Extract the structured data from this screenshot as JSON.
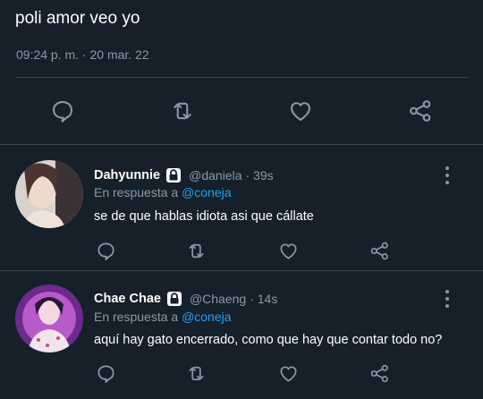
{
  "tweet": {
    "text": "poli amor veo yo",
    "meta": "09:24 p. m. · 20 mar. 22"
  },
  "icons": {
    "reply": "comment-icon",
    "retweet": "retweet-icon",
    "like": "heart-icon",
    "share": "share-icon",
    "lock": "lock-icon",
    "more": "more-vertical-icon"
  },
  "colors": {
    "background": "#15202b",
    "muted": "#8899a6",
    "link": "#1da1f2",
    "divider": "#38444d"
  },
  "replies": [
    {
      "name": "Dahyunnie",
      "handle": "@daniela",
      "time": "· 39s",
      "reply_prefix": "En respuesta a",
      "mention": "@coneja",
      "text": "se de que hablas idiota asi que cállate"
    },
    {
      "name": "Chae Chae",
      "handle": "@Chaeng",
      "time": "· 14s",
      "reply_prefix": "En respuesta a",
      "mention": "@coneja",
      "text": "aquí hay gato encerrado, como que hay que contar todo no?"
    }
  ]
}
